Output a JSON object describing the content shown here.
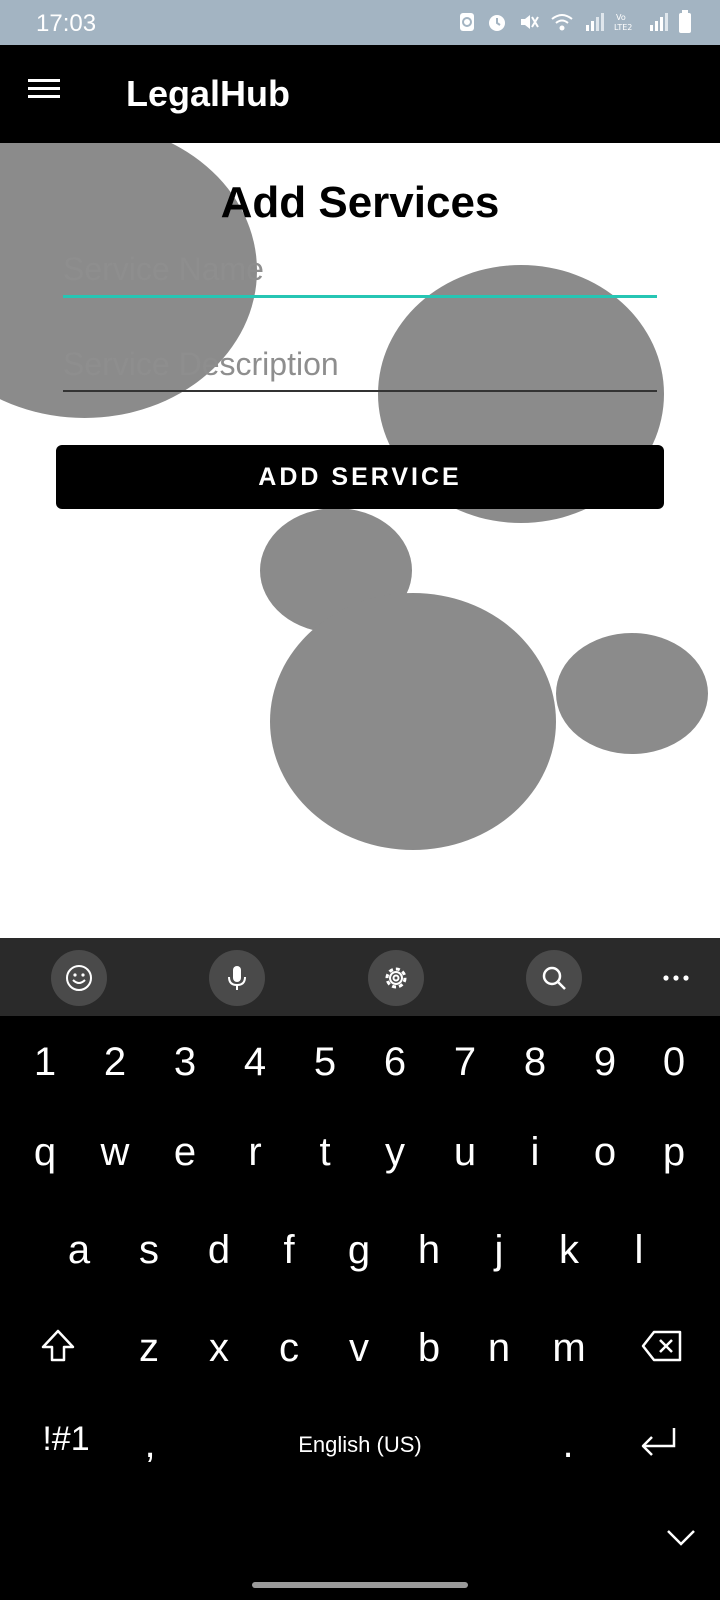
{
  "status_bar": {
    "time": "17:03",
    "icons": [
      "sync-icon",
      "alarm-icon",
      "mute-icon",
      "wifi-icon",
      "signal-icon",
      "volte-icon",
      "signal-icon-2",
      "battery-icon"
    ]
  },
  "app_bar": {
    "title": "LegalHub",
    "menu_icon": "hamburger-menu-icon"
  },
  "page": {
    "title": "Add Services",
    "service_name_placeholder": "Service Name",
    "service_name_value": "",
    "service_description_placeholder": "Service Description",
    "service_description_value": "",
    "add_button_label": "ADD SERVICE"
  },
  "colors": {
    "accent": "#26c6b4",
    "bubble": "#8b8b8b",
    "status_bar": "#a3b4c2",
    "app_bar": "#000000"
  },
  "keyboard": {
    "toolbar": [
      "emoji-icon",
      "microphone-icon",
      "settings-icon",
      "search-icon",
      "more-icon"
    ],
    "number_row": [
      "1",
      "2",
      "3",
      "4",
      "5",
      "6",
      "7",
      "8",
      "9",
      "0"
    ],
    "row1": [
      "q",
      "w",
      "e",
      "r",
      "t",
      "y",
      "u",
      "i",
      "o",
      "p"
    ],
    "row2": [
      "a",
      "s",
      "d",
      "f",
      "g",
      "h",
      "j",
      "k",
      "l"
    ],
    "row3": [
      "z",
      "x",
      "c",
      "v",
      "b",
      "n",
      "m"
    ],
    "symbols_label": "!#1",
    "comma": ",",
    "space_label": "English (US)",
    "period": "."
  }
}
